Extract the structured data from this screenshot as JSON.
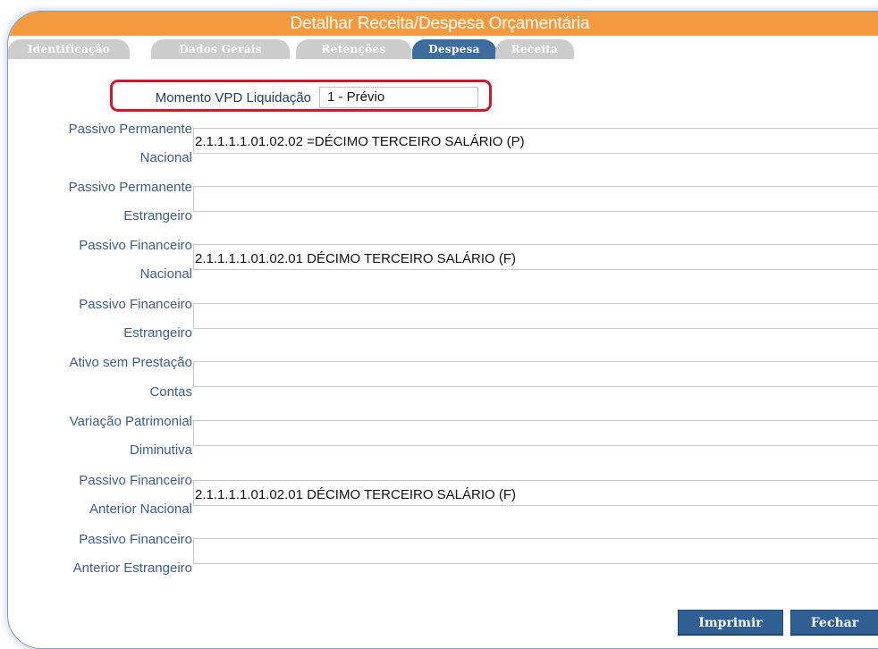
{
  "window": {
    "title": "Detalhar Receita/Despesa Orçamentária"
  },
  "tabs": [
    {
      "label": "Identificação",
      "active": false
    },
    {
      "label": "Dados Gerais",
      "active": false
    },
    {
      "label": "Retenções",
      "active": false
    },
    {
      "label": "Despesa",
      "active": true
    },
    {
      "label": "Receita",
      "active": false
    }
  ],
  "momento": {
    "label": "Momento VPD Liquidação",
    "value": "1 - Prévio"
  },
  "fields": [
    {
      "label_line1": "Passivo Permanente",
      "label_line2": "Nacional",
      "value": "2.1.1.1.1.01.02.02 =DÉCIMO TERCEIRO SALÁRIO (P)"
    },
    {
      "label_line1": "Passivo Permanente",
      "label_line2": "Estrangeiro",
      "value": ""
    },
    {
      "label_line1": "Passivo Financeiro",
      "label_line2": "Nacional",
      "value": "2.1.1.1.1.01.02.01 DÉCIMO TERCEIRO SALÁRIO (F)"
    },
    {
      "label_line1": "Passivo Financeiro",
      "label_line2": "Estrangeiro",
      "value": ""
    },
    {
      "label_line1": "Ativo sem Prestação",
      "label_line2": "Contas",
      "value": ""
    },
    {
      "label_line1": "Variação Patrimonial",
      "label_line2": "Diminutiva",
      "value": ""
    },
    {
      "label_line1": "Passivo Financeiro",
      "label_line2": "Anterior Nacional",
      "value": "2.1.1.1.1.01.02.01 DÉCIMO TERCEIRO SALÁRIO (F)"
    },
    {
      "label_line1": "Passivo Financeiro",
      "label_line2": "Anterior Estrangeiro",
      "value": ""
    }
  ],
  "buttons": {
    "print": "Imprimir",
    "close": "Fechar"
  },
  "colors": {
    "title_bar": "#f49a3e",
    "tab_active": "#3d6d9e",
    "tab_inactive": "#cdcdcd",
    "label_text": "#3e5d87",
    "highlight": "#d3152e",
    "button": "#2f5f93"
  }
}
